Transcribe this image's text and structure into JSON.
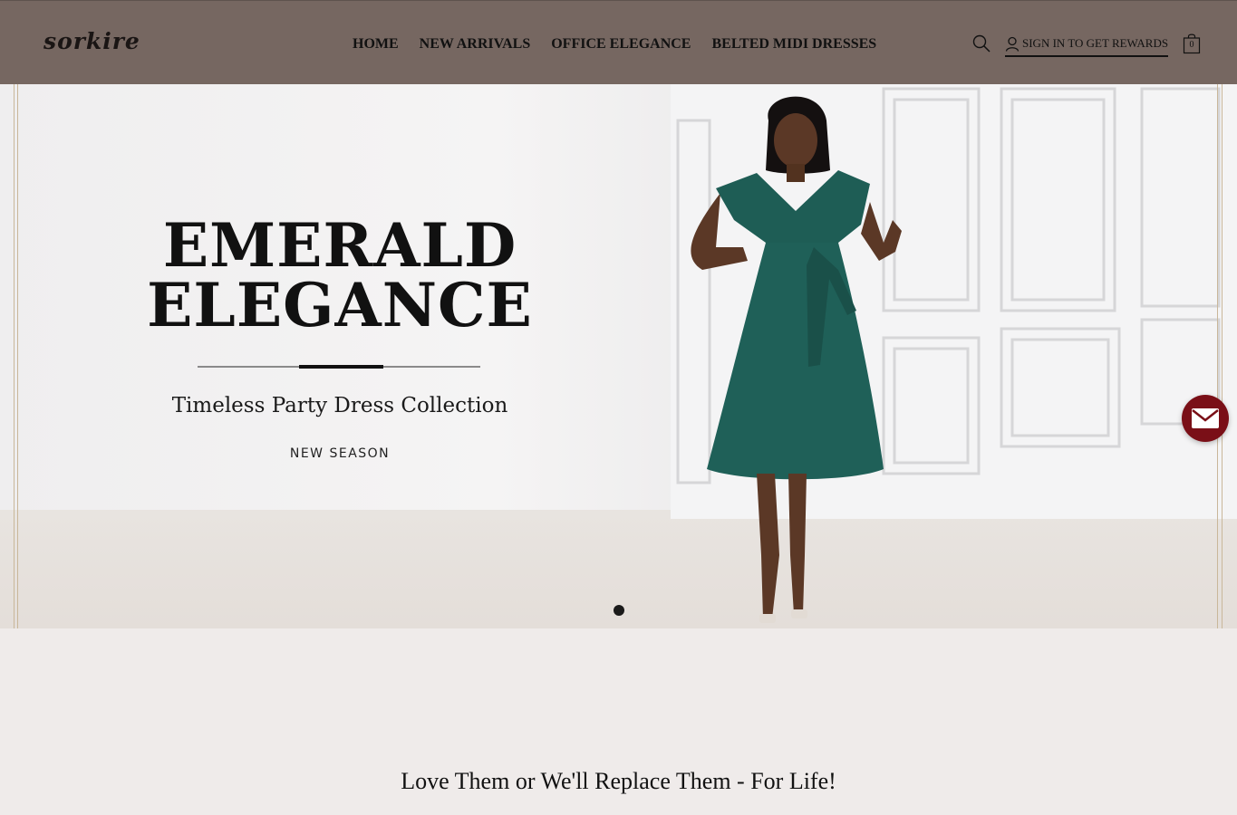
{
  "header": {
    "logo": "sorkire",
    "nav": [
      "HOME",
      "NEW ARRIVALS",
      "OFFICE ELEGANCE",
      "BELTED MIDI DRESSES"
    ],
    "search_icon": "search-icon",
    "signin_label": "SIGN IN TO GET REWARDS",
    "user_icon": "user-icon",
    "cart_icon": "shopping-bag-icon",
    "cart_count": "0",
    "background": "#766761"
  },
  "hero": {
    "title_line1": "EMERALD",
    "title_line2": "ELEGANCE",
    "subtitle": "Timeless Party Dress Collection",
    "tagline": "NEW SEASON",
    "dress_color": "#1e5d55",
    "slider_dots": 1,
    "active_dot": 1
  },
  "floating": {
    "mail_icon": "envelope-icon",
    "mail_color": "#7a0f17"
  },
  "guarantee": {
    "text": "Love Them or We'll Replace Them - For Life!"
  }
}
